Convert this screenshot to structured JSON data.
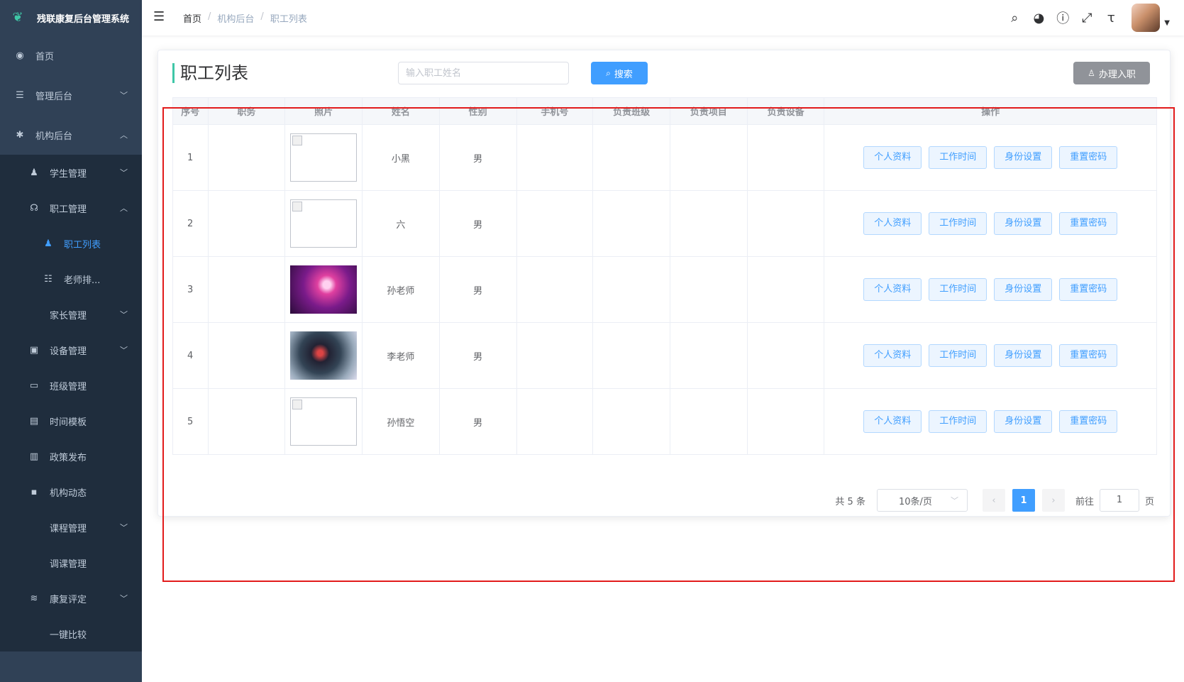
{
  "app": {
    "title": "残联康复后台管理系统"
  },
  "sidebar": {
    "items": [
      {
        "label": "首页",
        "icon": "dashboard-icon"
      },
      {
        "label": "管理后台",
        "icon": "server-icon"
      },
      {
        "label": "机构后台",
        "icon": "bug-icon"
      },
      {
        "label": "学生管理",
        "icon": "peoples-icon"
      },
      {
        "label": "职工管理",
        "icon": "headset-icon"
      },
      {
        "label": "职工列表",
        "icon": "user-icon"
      },
      {
        "label": "老师排...",
        "icon": "tree-icon"
      },
      {
        "label": "家长管理",
        "icon": ""
      },
      {
        "label": "设备管理",
        "icon": "briefcase-icon"
      },
      {
        "label": "班级管理",
        "icon": "monitor-icon"
      },
      {
        "label": "时间模板",
        "icon": "documentation-icon"
      },
      {
        "label": "政策发布",
        "icon": "book-icon"
      },
      {
        "label": "机构动态",
        "icon": "message-icon"
      },
      {
        "label": "课程管理",
        "icon": ""
      },
      {
        "label": "调课管理",
        "icon": ""
      },
      {
        "label": "康复评定",
        "icon": "layers-icon"
      },
      {
        "label": "一键比较",
        "icon": ""
      }
    ]
  },
  "navbar": {
    "breadcrumb": [
      "首页",
      "机构后台",
      "职工列表"
    ]
  },
  "page": {
    "title": "职工列表",
    "search_placeholder": "输入职工姓名",
    "search_label": "搜索",
    "onboard_label": "办理入职"
  },
  "table": {
    "headers": [
      "序号",
      "职务",
      "照片",
      "姓名",
      "性别",
      "手机号",
      "负责班级",
      "负责项目",
      "负责设备",
      "操作"
    ],
    "actions": [
      "个人资料",
      "工作时间",
      "身份设置",
      "重置密码"
    ],
    "rows": [
      {
        "idx": "1",
        "name": "小黑",
        "gender": "男"
      },
      {
        "idx": "2",
        "name": "六",
        "gender": "男"
      },
      {
        "idx": "3",
        "name": "孙老师",
        "gender": "男"
      },
      {
        "idx": "4",
        "name": "李老师",
        "gender": "男"
      },
      {
        "idx": "5",
        "name": "孙悟空",
        "gender": "男"
      }
    ]
  },
  "pagination": {
    "total": "共 5 条",
    "page_size": "10条/页",
    "current_page": "1",
    "goto_prefix": "前往",
    "goto_value": "1",
    "goto_suffix": "页"
  },
  "colors": {
    "sidebar_bg": "#304156",
    "accent": "#409eff",
    "annotation_box": "#e21b1b"
  }
}
